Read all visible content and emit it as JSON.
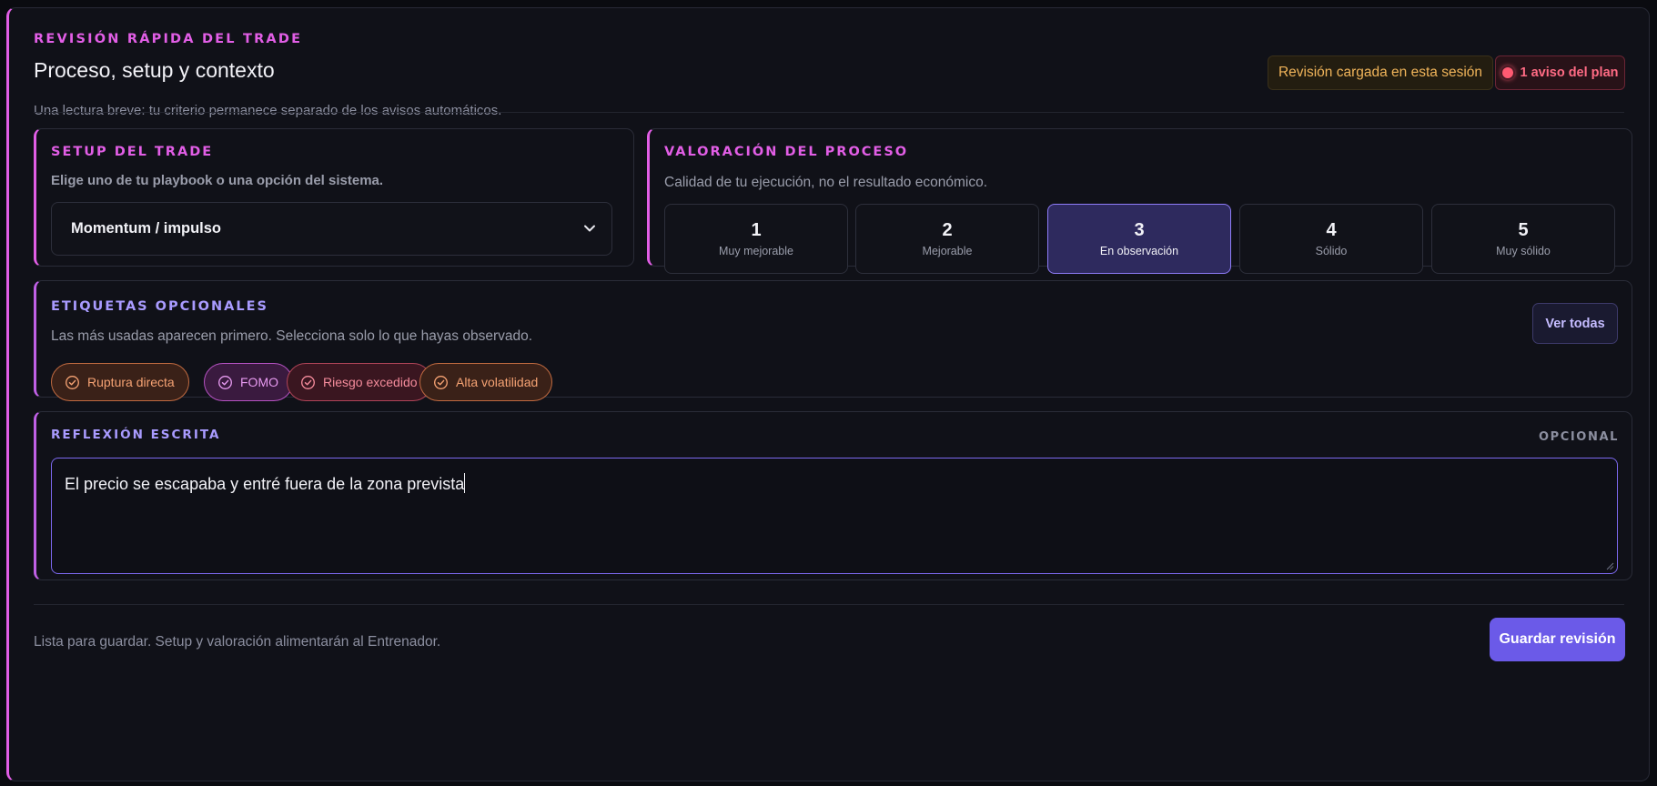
{
  "header": {
    "eyebrow": "REVISIÓN RÁPIDA DEL TRADE",
    "title": "Proceso, setup y contexto",
    "subtitle": "Una lectura breve: tu criterio permanece separado de los avisos automáticos.",
    "session_badge": "Revisión cargada en esta sesión",
    "plan_badge": "1 aviso del plan"
  },
  "setup": {
    "title": "SETUP DEL TRADE",
    "description": "Elige uno de tu playbook o una opción del sistema.",
    "selected": "Momentum / impulso"
  },
  "process": {
    "title": "VALORACIÓN DEL PROCESO",
    "description": "Calidad de tu ejecución, no el resultado económico.",
    "selected_value": 3,
    "ratings": [
      {
        "num": "1",
        "label": "Muy mejorable"
      },
      {
        "num": "2",
        "label": "Mejorable"
      },
      {
        "num": "3",
        "label": "En observación"
      },
      {
        "num": "4",
        "label": "Sólido"
      },
      {
        "num": "5",
        "label": "Muy sólido"
      }
    ]
  },
  "tags": {
    "title": "ETIQUETAS OPCIONALES",
    "description": "Las más usadas aparecen primero. Selecciona solo lo que hayas observado.",
    "see_all": "Ver todas",
    "items": [
      {
        "label": "Ruptura directa",
        "color": "orange"
      },
      {
        "label": "FOMO",
        "color": "magenta"
      },
      {
        "label": "Riesgo excedido",
        "color": "red"
      },
      {
        "label": "Alta volatilidad",
        "color": "orange"
      }
    ]
  },
  "reflection": {
    "title": "REFLEXIÓN ESCRITA",
    "optional": "OPCIONAL",
    "text": "El precio se escapaba y entré fuera de la zona prevista"
  },
  "footer": {
    "note": "Lista para guardar. Setup y valoración alimentarán al Entrenador.",
    "save_label": "Guardar revisión"
  },
  "colors": {
    "accent_magenta": "#e25ee6",
    "accent_violet": "#a99bff",
    "primary_button": "#6b5ae8",
    "warning": "#f0b45a",
    "danger": "#ff6b84"
  }
}
